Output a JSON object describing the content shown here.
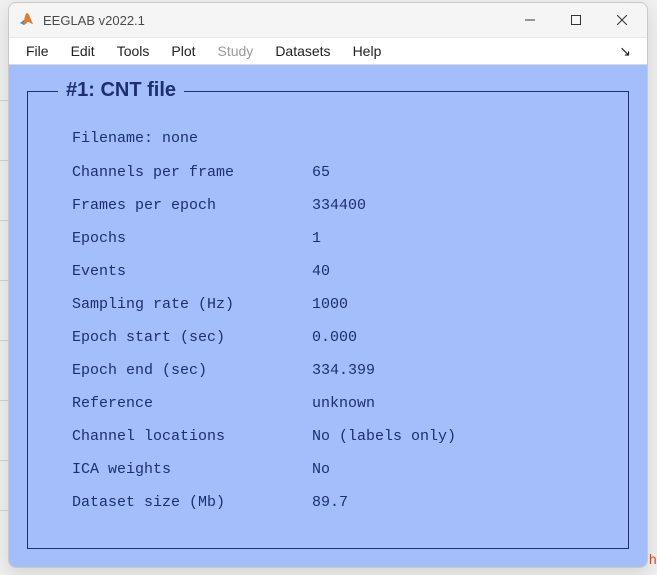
{
  "titlebar": {
    "title": "EEGLAB v2022.1"
  },
  "menubar": {
    "items": [
      {
        "label": "File",
        "enabled": true
      },
      {
        "label": "Edit",
        "enabled": true
      },
      {
        "label": "Tools",
        "enabled": true
      },
      {
        "label": "Plot",
        "enabled": true
      },
      {
        "label": "Study",
        "enabled": false
      },
      {
        "label": "Datasets",
        "enabled": true
      },
      {
        "label": "Help",
        "enabled": true
      }
    ]
  },
  "panel": {
    "title": "#1: CNT file",
    "filename_label": "Filename:",
    "filename_value": "none",
    "rows": [
      {
        "label": "Channels per frame",
        "value": "65"
      },
      {
        "label": "Frames per epoch",
        "value": "334400"
      },
      {
        "label": "Epochs",
        "value": "1"
      },
      {
        "label": "Events",
        "value": "40"
      },
      {
        "label": "Sampling rate (Hz)",
        "value": "1000"
      },
      {
        "label": "Epoch start (sec)",
        "value": " 0.000"
      },
      {
        "label": "Epoch end (sec)",
        "value": "334.399"
      },
      {
        "label": "Reference",
        "value": "unknown"
      },
      {
        "label": "Channel locations",
        "value": "No (labels only)"
      },
      {
        "label": "ICA weights",
        "value": "No"
      },
      {
        "label": "Dataset size (Mb)",
        "value": "89.7"
      }
    ]
  },
  "background_fragment": "h"
}
